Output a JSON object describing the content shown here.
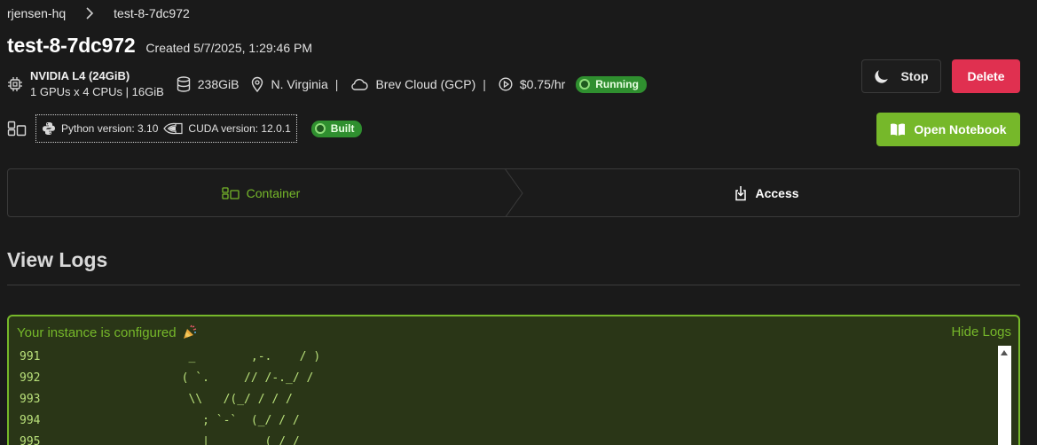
{
  "breadcrumb": {
    "org": "rjensen-hq",
    "instance": "test-8-7dc972"
  },
  "header": {
    "title": "test-8-7dc972",
    "created": "Created 5/7/2025, 1:29:46 PM"
  },
  "specs": {
    "gpu_name": "NVIDIA L4 (24GiB)",
    "gpu_config": "1 GPUs x 4 CPUs | 16GiB",
    "storage": "238GiB",
    "region": "N. Virginia",
    "pipe1": "|",
    "cloud": "Brev Cloud (GCP)",
    "pipe2": "|",
    "price": "$0.75/hr",
    "status": "Running"
  },
  "environment": {
    "python": "Python version: 3.10",
    "cuda": "CUDA version: 12.0.1",
    "build_status": "Built"
  },
  "actions": {
    "stop": "Stop",
    "delete": "Delete",
    "open_notebook": "Open Notebook"
  },
  "tabs": {
    "container": "Container",
    "access": "Access"
  },
  "logs": {
    "heading": "View Logs",
    "status": "Your instance is configured",
    "hide": "Hide Logs",
    "lines": [
      {
        "num": "991",
        "text": "         _        ,-.    / )"
      },
      {
        "num": "992",
        "text": "        ( `.     // /-._/ /"
      },
      {
        "num": "993",
        "text": "         \\\\   /(_/ / / /"
      },
      {
        "num": "994",
        "text": "           ; `-`  (_/ / /"
      },
      {
        "num": "995",
        "text": "           |        (_/ /"
      }
    ]
  },
  "colors": {
    "accent": "#76b82a",
    "danger": "#e03050",
    "badge": "#2f8f2f",
    "background": "#1a1a1a"
  }
}
